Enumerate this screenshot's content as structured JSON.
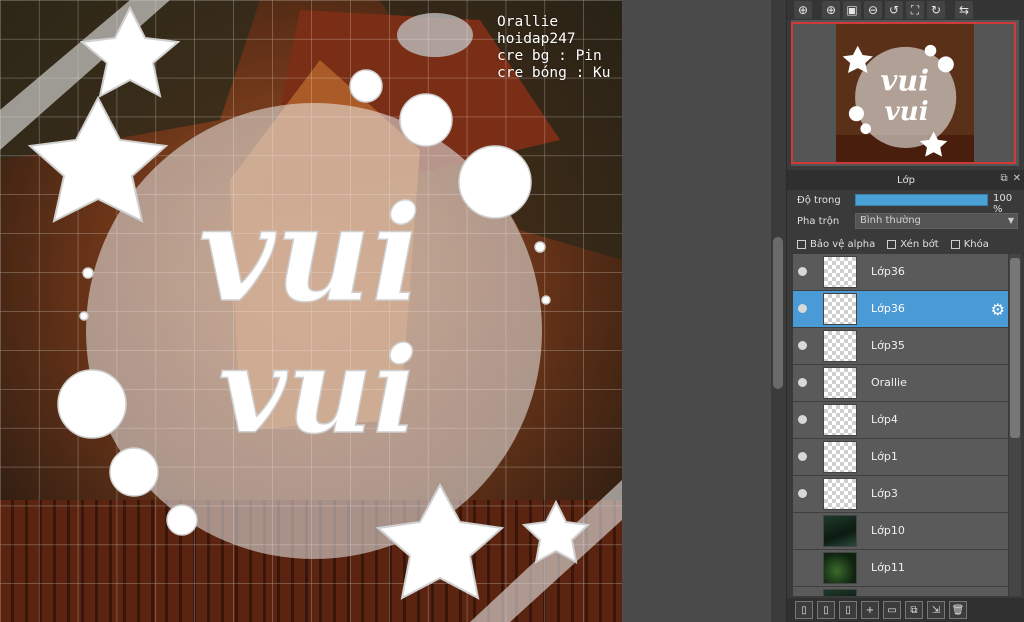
{
  "canvas": {
    "watermark_lines": [
      "Orallie",
      "hoidap247",
      "cre bg : Pin",
      "cre bóng : Ku"
    ],
    "art_text_line1": "vui",
    "art_text_line2": "vui"
  },
  "toolbar": {
    "buttons": [
      {
        "icon": "zoom-in-icon",
        "glyph": "⊕"
      },
      {
        "icon": "zoom-in-2-icon",
        "glyph": "⊕"
      },
      {
        "icon": "fit-screen-icon",
        "glyph": "▣"
      },
      {
        "icon": "zoom-out-icon",
        "glyph": "⊖"
      },
      {
        "icon": "rotate-left-icon",
        "glyph": "↺"
      },
      {
        "icon": "fullscreen-icon",
        "glyph": "⛶"
      },
      {
        "icon": "rotate-right-icon",
        "glyph": "↻"
      },
      {
        "icon": "flip-icon",
        "glyph": "⇆"
      }
    ]
  },
  "layer_panel": {
    "title": "Lớp",
    "opacity_label": "Độ trong",
    "opacity_value": "100 %",
    "opacity_fraction": 1.0,
    "blend_label": "Pha trộn",
    "blend_value": "Bình thường",
    "checkbox_protect_alpha": "Bảo vệ alpha",
    "checkbox_clipping": "Xén bớt",
    "checkbox_lock": "Khóa",
    "layers": [
      {
        "name": "Lớp36",
        "visible": true,
        "selected": false,
        "thumb": "transparent"
      },
      {
        "name": "Lớp36",
        "visible": true,
        "selected": true,
        "thumb": "transparent"
      },
      {
        "name": "Lớp35",
        "visible": true,
        "selected": false,
        "thumb": "transparent"
      },
      {
        "name": "Orallie",
        "visible": true,
        "selected": false,
        "thumb": "transparent"
      },
      {
        "name": "Lớp4",
        "visible": true,
        "selected": false,
        "thumb": "transparent"
      },
      {
        "name": "Lớp1",
        "visible": true,
        "selected": false,
        "thumb": "transparent"
      },
      {
        "name": "Lớp3",
        "visible": true,
        "selected": false,
        "thumb": "transparent"
      },
      {
        "name": "Lớp10",
        "visible": false,
        "selected": false,
        "thumb": "photo-a"
      },
      {
        "name": "Lớp11",
        "visible": false,
        "selected": false,
        "thumb": "photo-b"
      },
      {
        "name": "",
        "visible": false,
        "selected": false,
        "thumb": "photo-a"
      }
    ]
  },
  "bottom_bar": {
    "buttons": [
      {
        "icon": "new-layer-icon",
        "glyph": "▯"
      },
      {
        "icon": "new-raster-layer-icon",
        "glyph": "▯"
      },
      {
        "icon": "new-layer-alt-icon",
        "glyph": "▯"
      },
      {
        "icon": "add-menu-icon",
        "glyph": "+"
      },
      {
        "icon": "folder-icon",
        "glyph": "▭"
      },
      {
        "icon": "duplicate-layer-icon",
        "glyph": "⧉"
      },
      {
        "icon": "merge-down-icon",
        "glyph": "⇲"
      },
      {
        "icon": "delete-layer-icon",
        "glyph": "🗑"
      }
    ]
  },
  "colors": {
    "accent": "#4a9ad6",
    "nav_rect": "#d13a3a"
  }
}
